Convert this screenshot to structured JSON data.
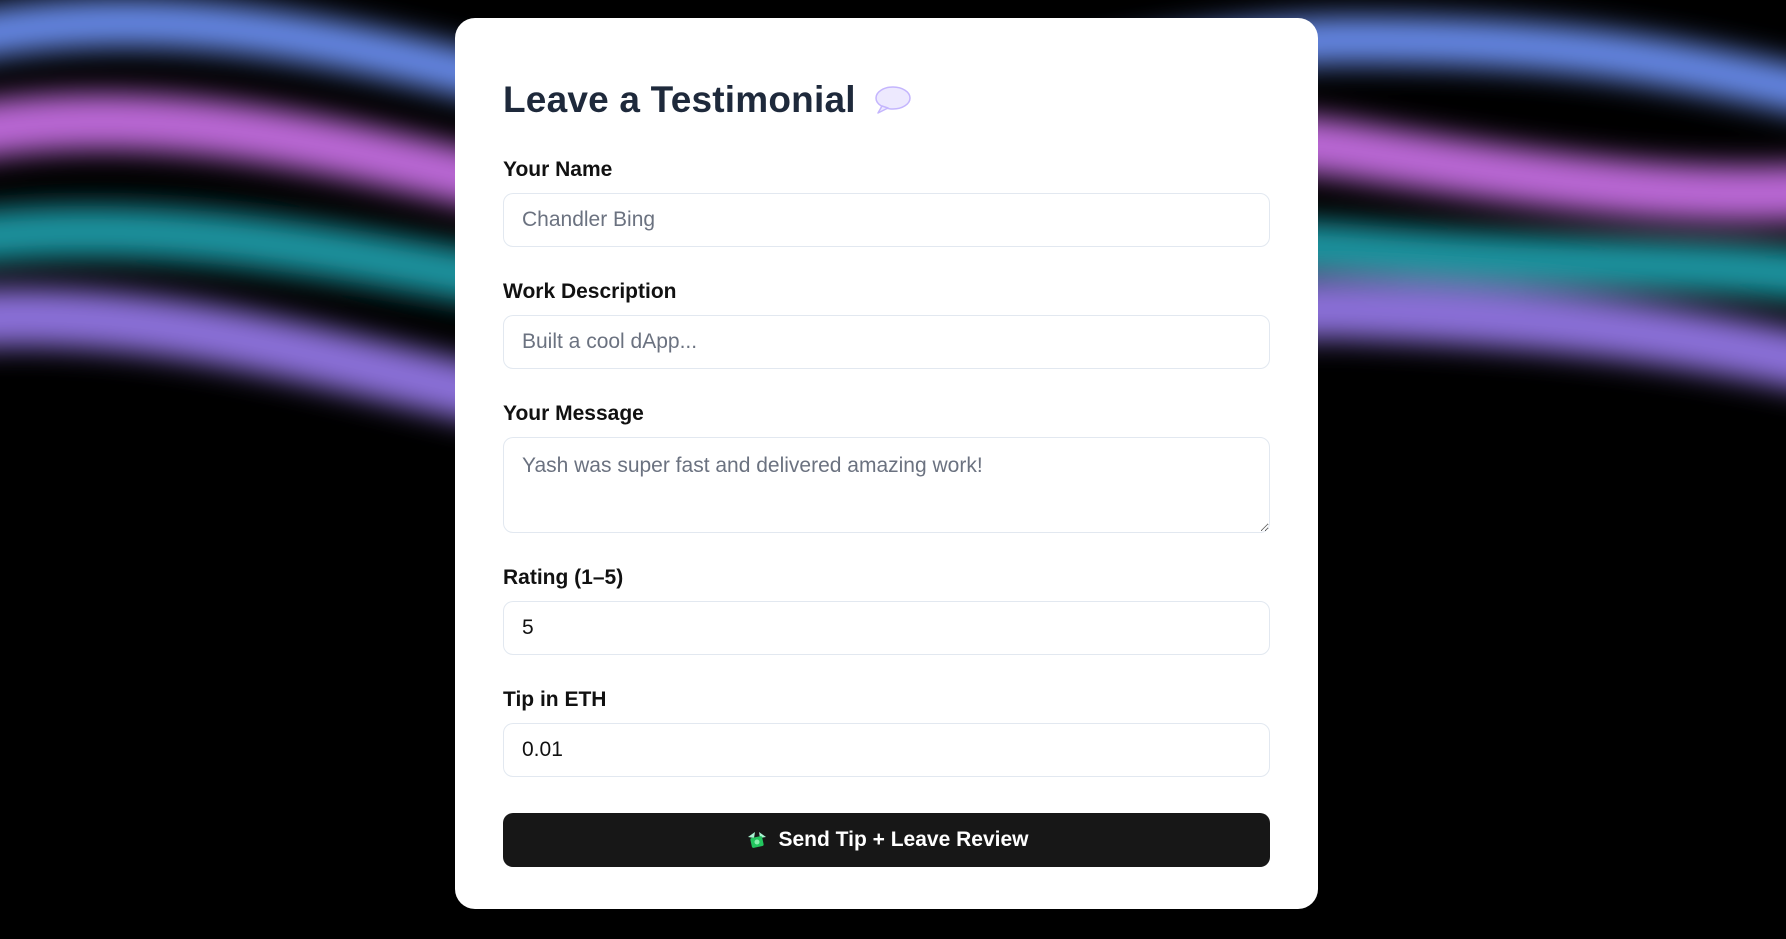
{
  "form": {
    "title": "Leave a Testimonial",
    "title_icon": "speech-bubble-icon",
    "fields": {
      "name": {
        "label": "Your Name",
        "placeholder": "Chandler Bing",
        "value": ""
      },
      "work": {
        "label": "Work Description",
        "placeholder": "Built a cool dApp...",
        "value": ""
      },
      "message": {
        "label": "Your Message",
        "placeholder": "Yash was super fast and delivered amazing work!",
        "value": ""
      },
      "rating": {
        "label": "Rating (1–5)",
        "placeholder": "",
        "value": "5"
      },
      "tip": {
        "label": "Tip in ETH",
        "placeholder": "",
        "value": "0.01"
      }
    },
    "submit": {
      "label": "Send Tip + Leave Review",
      "icon": "money-with-wings-icon"
    }
  },
  "colors": {
    "page_background": "#000000",
    "card_background": "#ffffff",
    "title_color": "#1e293b",
    "button_background": "#171717",
    "wave_blue": "#6a8ef0",
    "wave_pink": "#c46ee0",
    "wave_teal": "#1fa3b0",
    "wave_violet": "#9a7cf0"
  }
}
